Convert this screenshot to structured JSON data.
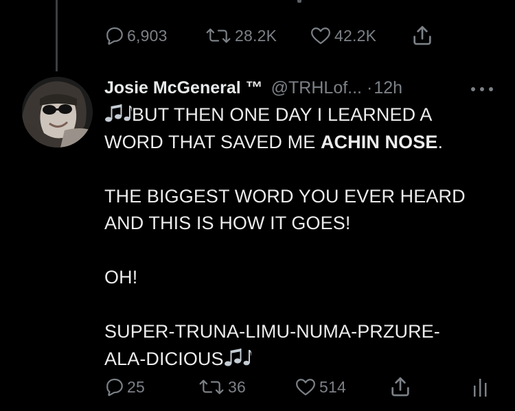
{
  "prev_tweet": {
    "reply_count": "6,903",
    "retweet_count": "28.2K",
    "like_count": "42.2K"
  },
  "tweet": {
    "display_name": "Josie McGeneral ™",
    "handle": "@TRHLof...",
    "separator": "·",
    "time": "12h",
    "lines": {
      "l1": "BUT THEN ONE DAY I LEARNED A",
      "l2a": "WORD THAT SAVED ME ",
      "l2b": "ACHIN NOSE",
      "l2c": ".",
      "l3": "THE BIGGEST WORD YOU EVER HEARD",
      "l4": "AND THIS IS HOW IT GOES!",
      "l5": "OH!",
      "l6": "SUPER-TRUNA-LIMU-NUMA-PRZURE-",
      "l7": "ALA-DICIOUS"
    },
    "reply_count": "25",
    "retweet_count": "36",
    "like_count": "514"
  },
  "icons": {
    "reply": "reply-icon",
    "retweet": "retweet-icon",
    "like": "heart-icon",
    "share": "share-icon",
    "analytics": "analytics-icon",
    "more": "more-icon",
    "music": "music-notes-icon"
  },
  "colors": {
    "background": "#000000",
    "text": "#e7e9ea",
    "muted": "#7c8187",
    "note": "#c4ccd4"
  }
}
